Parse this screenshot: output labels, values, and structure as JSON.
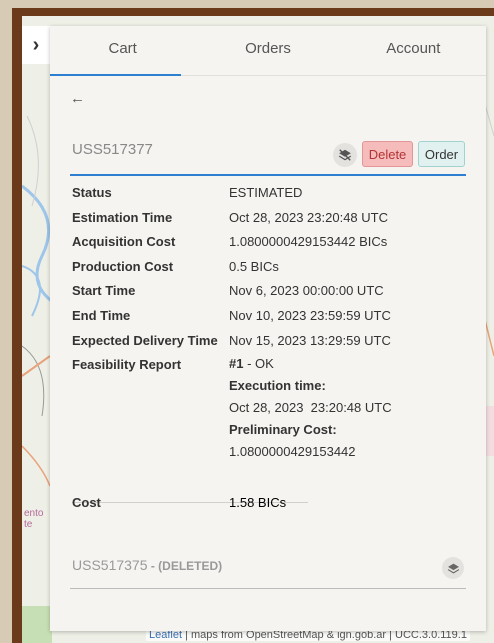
{
  "tabs": [
    {
      "label": "Cart"
    },
    {
      "label": "Orders"
    },
    {
      "label": "Account"
    }
  ],
  "nav": {
    "collapse_glyph": "›",
    "back_glyph": "←"
  },
  "item": {
    "id": "USS517377",
    "delete_label": "Delete",
    "order_label": "Order",
    "details": [
      {
        "key": "Status",
        "value": "ESTIMATED"
      },
      {
        "key": "Estimation Time",
        "value": "Oct 28, 2023 23:20:48 UTC"
      },
      {
        "key": "Acquisition Cost",
        "value": "1.0800000429153442 BICs"
      },
      {
        "key": "Production Cost",
        "value": "0.5 BICs"
      },
      {
        "key": "Start Time",
        "value": "Nov 6, 2023 00:00:00 UTC"
      },
      {
        "key": "End Time",
        "value": "Nov 10, 2023 23:59:59 UTC"
      },
      {
        "key": "Expected Delivery Time",
        "value": "Nov 15, 2023 13:29:59 UTC"
      }
    ],
    "feasibility": {
      "key": "Feasibility Report",
      "number": "#1",
      "status": " - OK",
      "exec_label": "Execution time:",
      "exec_value": "Oct 28, 2023  23:20:48 UTC",
      "prelim_label": "Preliminary Cost:",
      "prelim_value": "1.0800000429153442"
    },
    "cost": {
      "key": "Cost",
      "value": "1.58 BICs"
    }
  },
  "deleted_item": {
    "id": "USS517375",
    "tag": " - (DELETED)"
  },
  "map": {
    "partial_label": "ento\nte",
    "attribution_link": "Leaflet",
    "attribution_rest": " | maps from OpenStreetMap & ign.gob.ar | UCC.3.0.119.1"
  },
  "colors": {
    "accent": "#2f7fd1",
    "delete_bg": "#f6bbbb",
    "order_bg": "#e1f1f0"
  },
  "icons": [
    "chevron-right-icon",
    "back-arrow-icon",
    "layers-off-icon",
    "layers-icon"
  ]
}
